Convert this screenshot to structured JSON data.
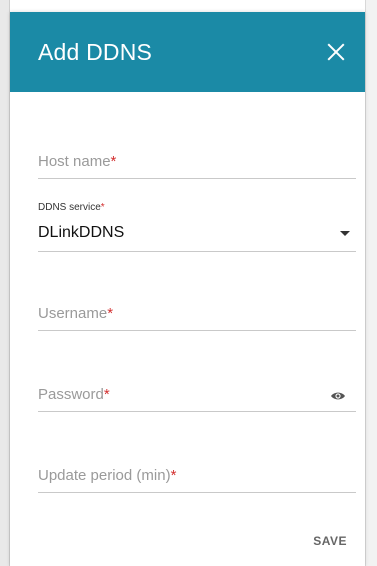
{
  "dialog": {
    "title": "Add DDNS",
    "close_icon": "close-icon"
  },
  "fields": {
    "host_name": {
      "placeholder": "Host name",
      "required_mark": "*",
      "value": ""
    },
    "ddns_service": {
      "label": "DDNS service",
      "required_mark": "*",
      "value": "DLinkDDNS"
    },
    "username": {
      "placeholder": "Username",
      "required_mark": "*",
      "value": ""
    },
    "password": {
      "placeholder": "Password",
      "required_mark": "*",
      "value": "",
      "toggle_icon": "eye-icon"
    },
    "update_period": {
      "placeholder": "Update period (min)",
      "required_mark": "*",
      "value": ""
    }
  },
  "actions": {
    "save_label": "SAVE"
  },
  "colors": {
    "header": "#1b8aa6",
    "required": "#d32f2f"
  }
}
